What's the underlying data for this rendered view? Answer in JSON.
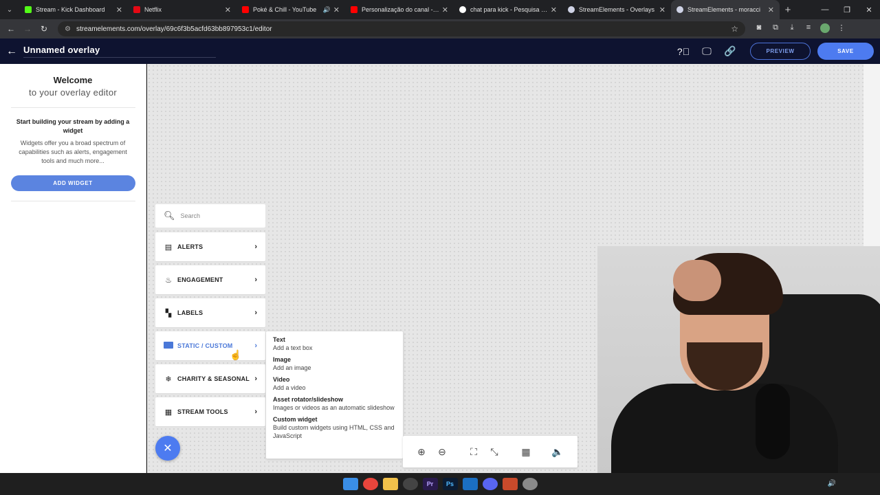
{
  "browser": {
    "tabs": [
      {
        "title": "Stream - Kick Dashboard",
        "color": "#53fc18",
        "active": false
      },
      {
        "title": "Netflix",
        "color": "#e50914",
        "active": false
      },
      {
        "title": "Poké & Chill - YouTube",
        "color": "#ff0000",
        "active": false,
        "audio": true
      },
      {
        "title": "Personalização do canal - YouT",
        "color": "#ff0000",
        "active": false
      },
      {
        "title": "chat para kick - Pesquisa Googl",
        "color": "#ffffff",
        "active": false
      },
      {
        "title": "StreamElements - Overlays",
        "color": "#cfd3e6",
        "active": false
      },
      {
        "title": "StreamElements - moracci",
        "color": "#cfd3e6",
        "active": true
      }
    ],
    "url": "streamelements.com/overlay/69c6f3b5acfd63bb897953c1/editor"
  },
  "header": {
    "title": "Unnamed overlay",
    "preview_label": "PREVIEW",
    "save_label": "SAVE"
  },
  "sidebar": {
    "welcome": "Welcome",
    "subtitle": "to your overlay editor",
    "headline": "Start building your stream by adding a widget",
    "description": "Widgets offer you a broad spectrum of capabilities such as alerts, engagement tools and much more...",
    "add_widget_label": "ADD WIDGET"
  },
  "widget_menu": {
    "search_placeholder": "Search",
    "categories": [
      {
        "label": "ALERTS",
        "icon": "alerts-icon"
      },
      {
        "label": "ENGAGEMENT",
        "icon": "flame-icon"
      },
      {
        "label": "LABELS",
        "icon": "labels-icon"
      },
      {
        "label": "STATIC / CUSTOM",
        "icon": "static-custom-icon",
        "active": true
      },
      {
        "label": "CHARITY & SEASONAL",
        "icon": "snowflake-icon"
      },
      {
        "label": "STREAM TOOLS",
        "icon": "stream-tools-icon"
      }
    ],
    "submenu": [
      {
        "title": "Text",
        "desc": "Add a text box"
      },
      {
        "title": "Image",
        "desc": "Add an image"
      },
      {
        "title": "Video",
        "desc": "Add a video"
      },
      {
        "title": "Asset rotator/slideshow",
        "desc": "Images or videos as an automatic slideshow"
      },
      {
        "title": "Custom widget",
        "desc": "Build custom widgets using HTML, CSS and JavaScript"
      }
    ]
  },
  "colors": {
    "accent": "#4d7bf0",
    "header_bg": "#0e1330",
    "active_category": "#4a78d8"
  }
}
